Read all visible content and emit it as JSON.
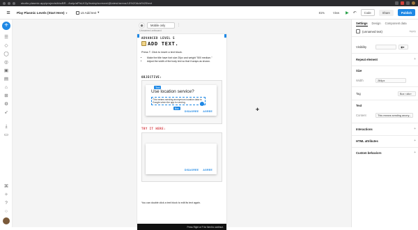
{
  "browser": {
    "url": "studio.plasmic.app/projects/bbzBR.../ka/p/aFfsLK2y/brainy/scream/@latest/arena/L5%20Add%20text"
  },
  "header": {
    "project_name": "Play Plasmic Levels (Start Here)",
    "page_name": "L5 Add text",
    "zoom": "81%",
    "view_label": "View",
    "code_label": "Code",
    "share_label": "Share",
    "publish_label": "Publish"
  },
  "canvas": {
    "variant_select": "Mobile only",
    "artboard_label": "Unnamed artboard",
    "content": {
      "eyebrow": "ADVANCED LEVEL 5",
      "title": "ADD TEXT.",
      "intro": "Press T. Click to insert a text block.",
      "bullets": [
        "Make the title have font size 20px and weight \"500 medium.\"",
        "Adjust the width of the body text so that it wraps as shown."
      ],
      "objective_label": "OBJECTIVE:",
      "try_label": "TRY IT HERE:",
      "dialog_title": "Use location service?",
      "dialog_body": "This means sending anonymous location data to Google when the app is running.",
      "dialog_tag": "Text",
      "dialog_chip": "Box",
      "disagree": "DISAGREE",
      "agree": "AGREE",
      "footer_text": "You can double click a text block to edit its text again.",
      "bottom_bar_text": "Press Right or F for Next to continue."
    }
  },
  "inspector": {
    "tabs": [
      "Settings",
      "Design",
      "Component data"
    ],
    "element_name": "(unnamed text)",
    "apply_label": "Apply",
    "visibility_label": "Visibility",
    "repeat_label": "Repeat element",
    "size_label": "Size",
    "width_label": "Width",
    "width_value": "284px",
    "tag_label": "Tag",
    "tag_value": "Box <div>",
    "text_label": "Text",
    "content_label": "Content",
    "content_value": "This means sending anony...",
    "interactions_label": "Interactions",
    "html_attributes_label": "HTML attributes",
    "custom_behaviors_label": "Custom behaviors"
  }
}
